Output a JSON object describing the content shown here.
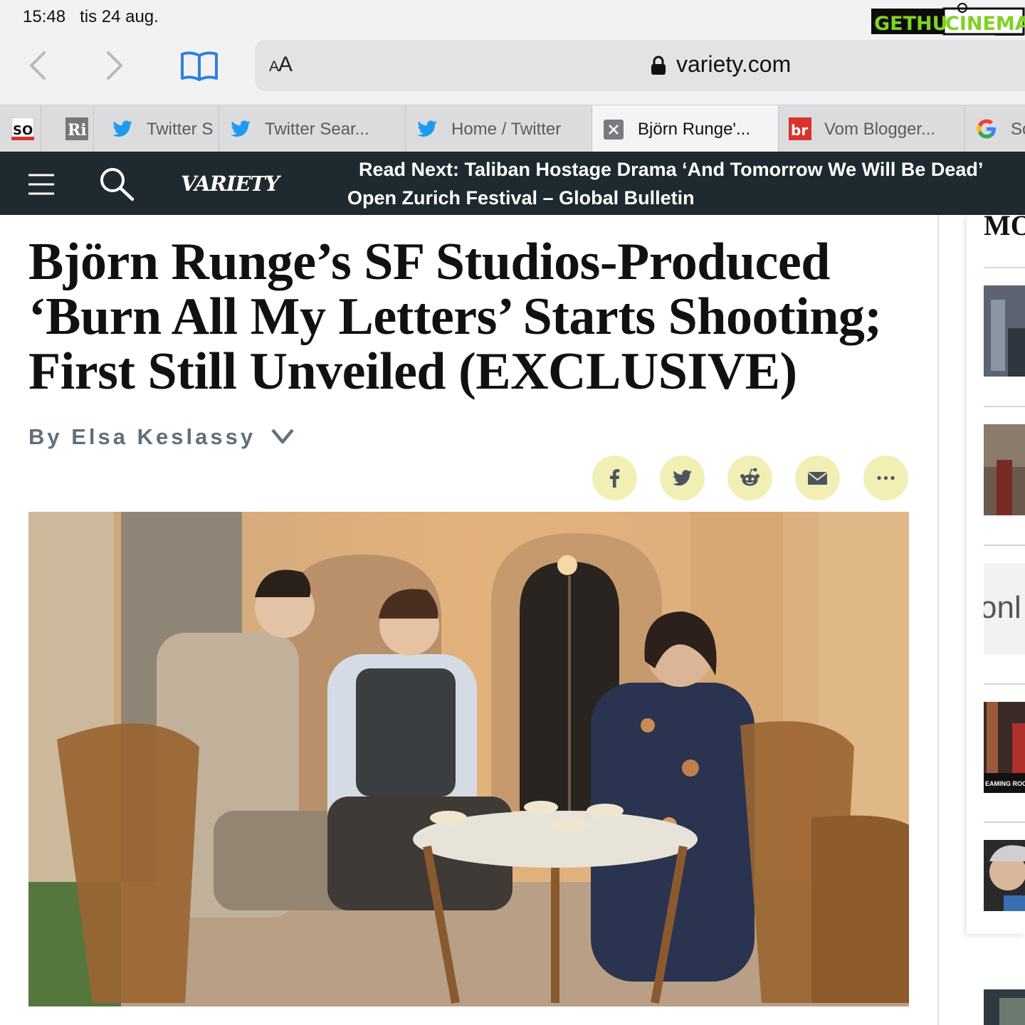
{
  "status_bar": {
    "time": "15:48",
    "date": "tis 24 aug."
  },
  "watermark": {
    "part1": "GETHU",
    "part2": "CINEMA"
  },
  "browser": {
    "text_size_label_small": "A",
    "text_size_label_large": "A",
    "url": "variety.com",
    "tabs": [
      {
        "label": "",
        "icon": "so-favicon",
        "badge": "SO"
      },
      {
        "label": "",
        "icon": "ri-favicon",
        "badge": "Ri"
      },
      {
        "label": "Twitter S",
        "icon": "twitter-bird-icon"
      },
      {
        "label": "Twitter Sear...",
        "icon": "twitter-bird-icon"
      },
      {
        "label": "Home / Twitter",
        "icon": "twitter-bird-icon"
      },
      {
        "label": "Björn Runge'...",
        "icon": "close-tab-icon",
        "active": true
      },
      {
        "label": "Vom Blogger...",
        "icon": "br-favicon",
        "badge": "br"
      },
      {
        "label": "Sc",
        "icon": "google-icon"
      }
    ]
  },
  "site": {
    "logo": "VARIETY",
    "read_next_line1": "Read Next: Taliban Hostage Drama ‘And Tomorrow We Will Be Dead’",
    "read_next_line2": "Open Zurich Festival – Global Bulletin"
  },
  "article": {
    "headline_line1": "Björn Runge’s SF Studios-Produced",
    "headline_line2": "‘Burn All My Letters’ Starts Shooting;",
    "headline_line3": "First Still Unveiled (EXCLUSIVE)",
    "byline": "By Elsa Keslassy",
    "share_buttons": [
      "facebook-icon",
      "twitter-icon",
      "reddit-icon",
      "email-icon",
      "more-icon"
    ],
    "colors": {
      "share_bg": "#f1efb4",
      "share_icon": "#4a5560",
      "header_bg": "#1f2a30",
      "byline": "#5f707d"
    }
  },
  "sidebar": {
    "title": "MO",
    "thumb3_text": "onl",
    "thumb4_caption": "EAMING ROOM"
  }
}
